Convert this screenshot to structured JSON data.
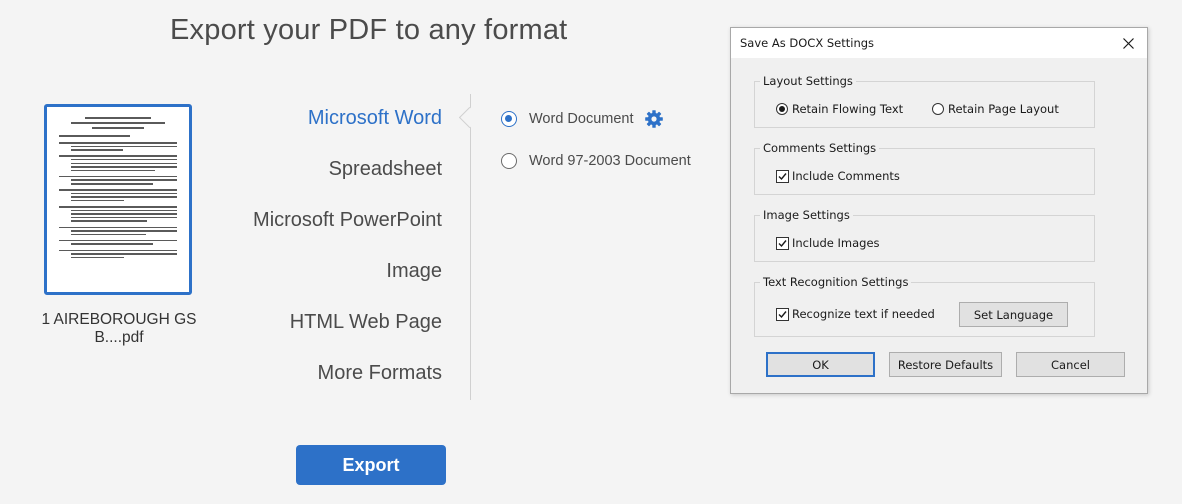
{
  "page": {
    "title": "Export your PDF to any format"
  },
  "file": {
    "name": "1 AIREBOROUGH GS B....pdf"
  },
  "formats": [
    {
      "label": "Microsoft Word",
      "selected": true
    },
    {
      "label": "Spreadsheet",
      "selected": false
    },
    {
      "label": "Microsoft PowerPoint",
      "selected": false
    },
    {
      "label": "Image",
      "selected": false
    },
    {
      "label": "HTML Web Page",
      "selected": false
    },
    {
      "label": "More Formats",
      "selected": false
    }
  ],
  "word_options": [
    {
      "label": "Word Document",
      "selected": true,
      "icon": "gear-icon"
    },
    {
      "label": "Word 97-2003 Document",
      "selected": false
    }
  ],
  "export": {
    "label": "Export"
  },
  "dialog": {
    "title": "Save As DOCX Settings",
    "layout": {
      "label": "Layout Settings",
      "options": [
        {
          "label": "Retain Flowing Text",
          "selected": true
        },
        {
          "label": "Retain Page Layout",
          "selected": false
        }
      ]
    },
    "comments": {
      "label": "Comments Settings",
      "checkbox": "Include Comments",
      "checked": true
    },
    "images": {
      "label": "Image Settings",
      "checkbox": "Include Images",
      "checked": true
    },
    "ocr": {
      "label": "Text Recognition Settings",
      "checkbox": "Recognize text if needed",
      "checked": true,
      "button": "Set Language"
    },
    "buttons": {
      "ok": "OK",
      "restore": "Restore Defaults",
      "cancel": "Cancel"
    }
  },
  "colors": {
    "accent": "#2d71c8",
    "background": "#f4f4f4"
  }
}
